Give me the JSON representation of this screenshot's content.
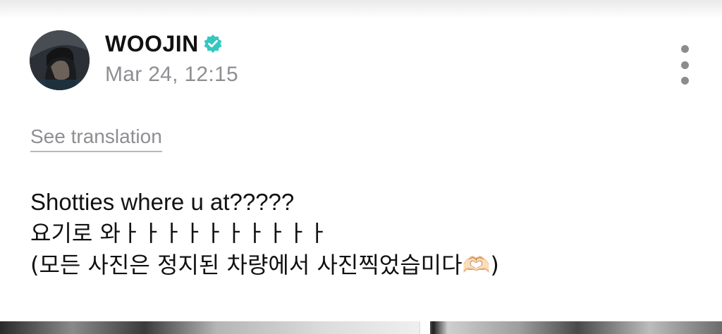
{
  "post": {
    "author": {
      "name": "WOOJIN",
      "verified_icon": "verified-check-badge",
      "verified_color": "#35c6c0"
    },
    "timestamp": "Mar 24, 12:15",
    "menu_icon": "vertical-ellipsis",
    "translation_link": "See translation",
    "body_lines": [
      "Shotties where u at?????",
      "요기로 와ㅏㅏㅏㅏㅏㅏㅏㅏㅏㅏ",
      "(모든 사진은 정지된 차량에서 사진찍었습미다🫶🏻)"
    ]
  }
}
